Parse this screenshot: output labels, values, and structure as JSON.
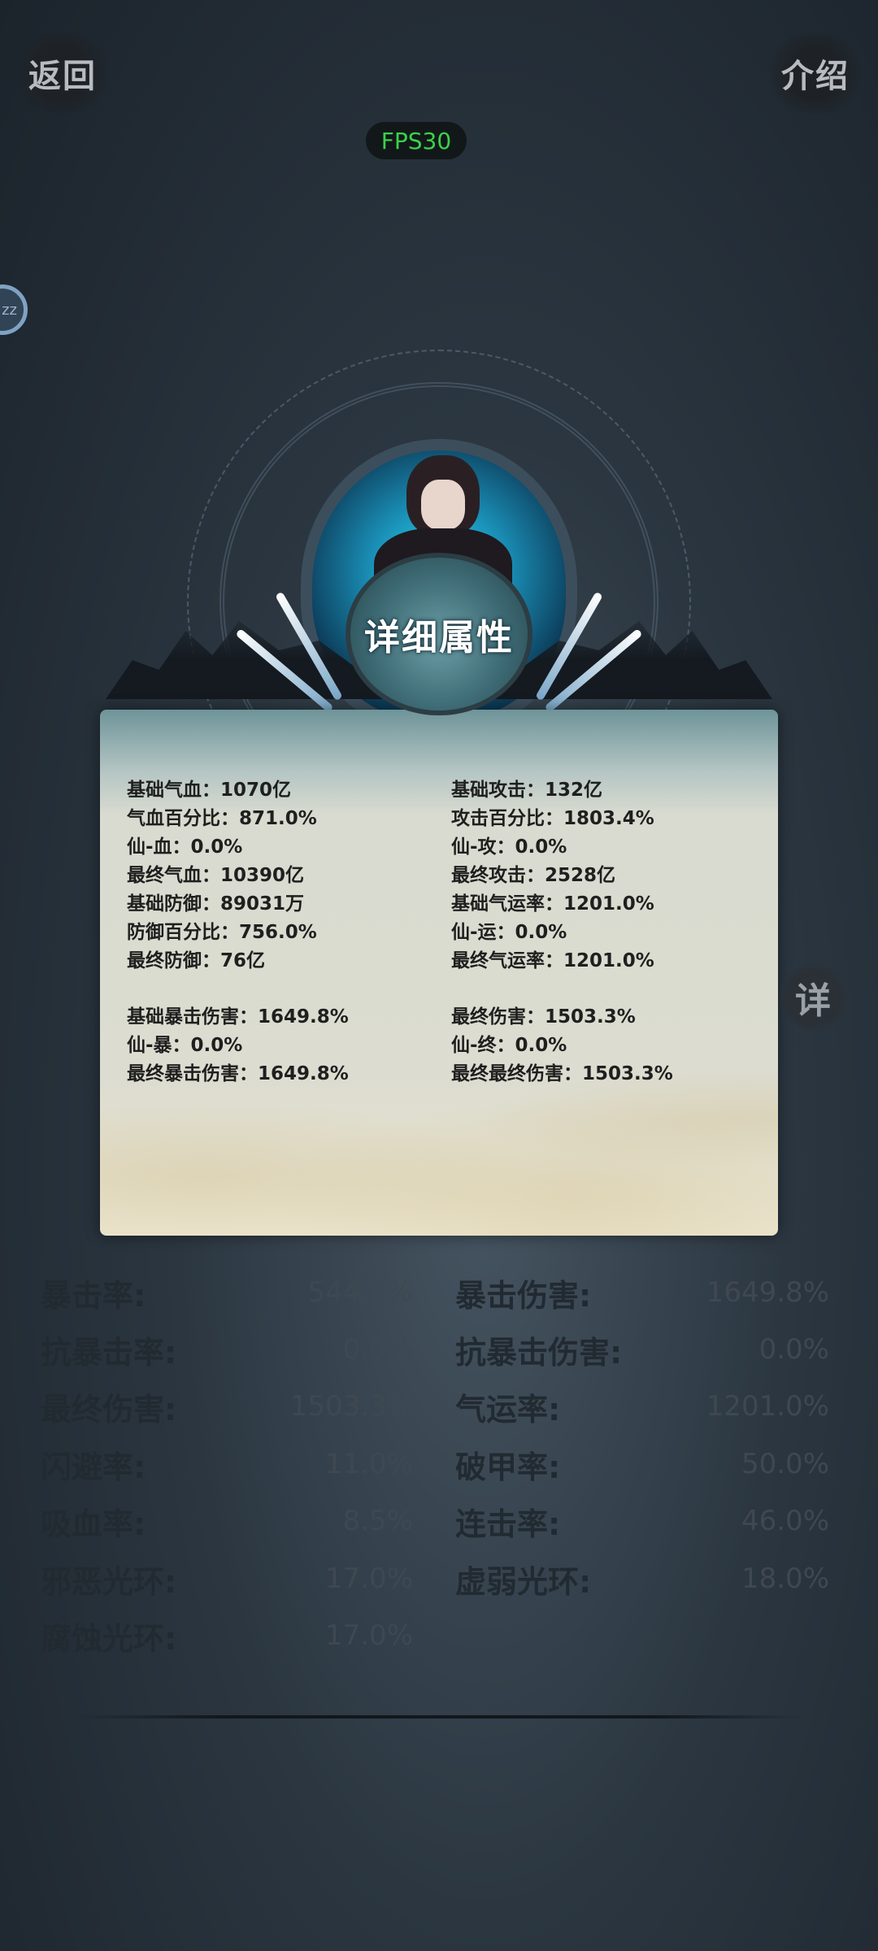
{
  "header": {
    "back_label": "返回",
    "intro_label": "介绍",
    "fps_label": "FPS30"
  },
  "side_avatar_text": "zz",
  "detail_button_label": "详",
  "panel": {
    "title": "详细属性",
    "left": [
      [
        "基础气血：1070亿",
        "气血百分比：871.0%",
        "仙-血：0.0%",
        "最终气血：10390亿"
      ],
      [
        "基础防御：89031万",
        "防御百分比：756.0%",
        "最终防御：76亿"
      ],
      [
        "基础暴击伤害：1649.8%",
        "仙-暴：0.0%",
        "最终暴击伤害：1649.8%"
      ]
    ],
    "right": [
      [
        "基础攻击：132亿",
        "攻击百分比：1803.4%",
        "仙-攻：0.0%",
        "最终攻击：2528亿"
      ],
      [
        "基础气运率：1201.0%",
        "仙-运：0.0%",
        "最终气运率：1201.0%"
      ],
      [
        "最终伤害：1503.3%",
        "仙-终：0.0%",
        "最终最终伤害：1503.3%"
      ]
    ]
  },
  "stats_list": {
    "left": [
      {
        "label": "暴击率:",
        "value": "544.0%"
      },
      {
        "label": "抗暴击率:",
        "value": "0.0%"
      },
      {
        "label": "最终伤害:",
        "value": "1503.3%"
      },
      {
        "label": "闪避率:",
        "value": "11.0%"
      },
      {
        "label": "吸血率:",
        "value": "8.5%"
      },
      {
        "label": "邪恶光环:",
        "value": "17.0%"
      },
      {
        "label": "腐蚀光环:",
        "value": "17.0%"
      }
    ],
    "right": [
      {
        "label": "暴击伤害:",
        "value": "1649.8%"
      },
      {
        "label": "抗暴击伤害:",
        "value": "0.0%"
      },
      {
        "label": "气运率:",
        "value": "1201.0%"
      },
      {
        "label": "破甲率:",
        "value": "50.0%"
      },
      {
        "label": "连击率:",
        "value": "46.0%"
      },
      {
        "label": "虚弱光环:",
        "value": "18.0%"
      }
    ]
  },
  "colors": {
    "fps_green": "#39d24a",
    "panel_teal": "#6e9499",
    "title_white": "#ffffff"
  }
}
